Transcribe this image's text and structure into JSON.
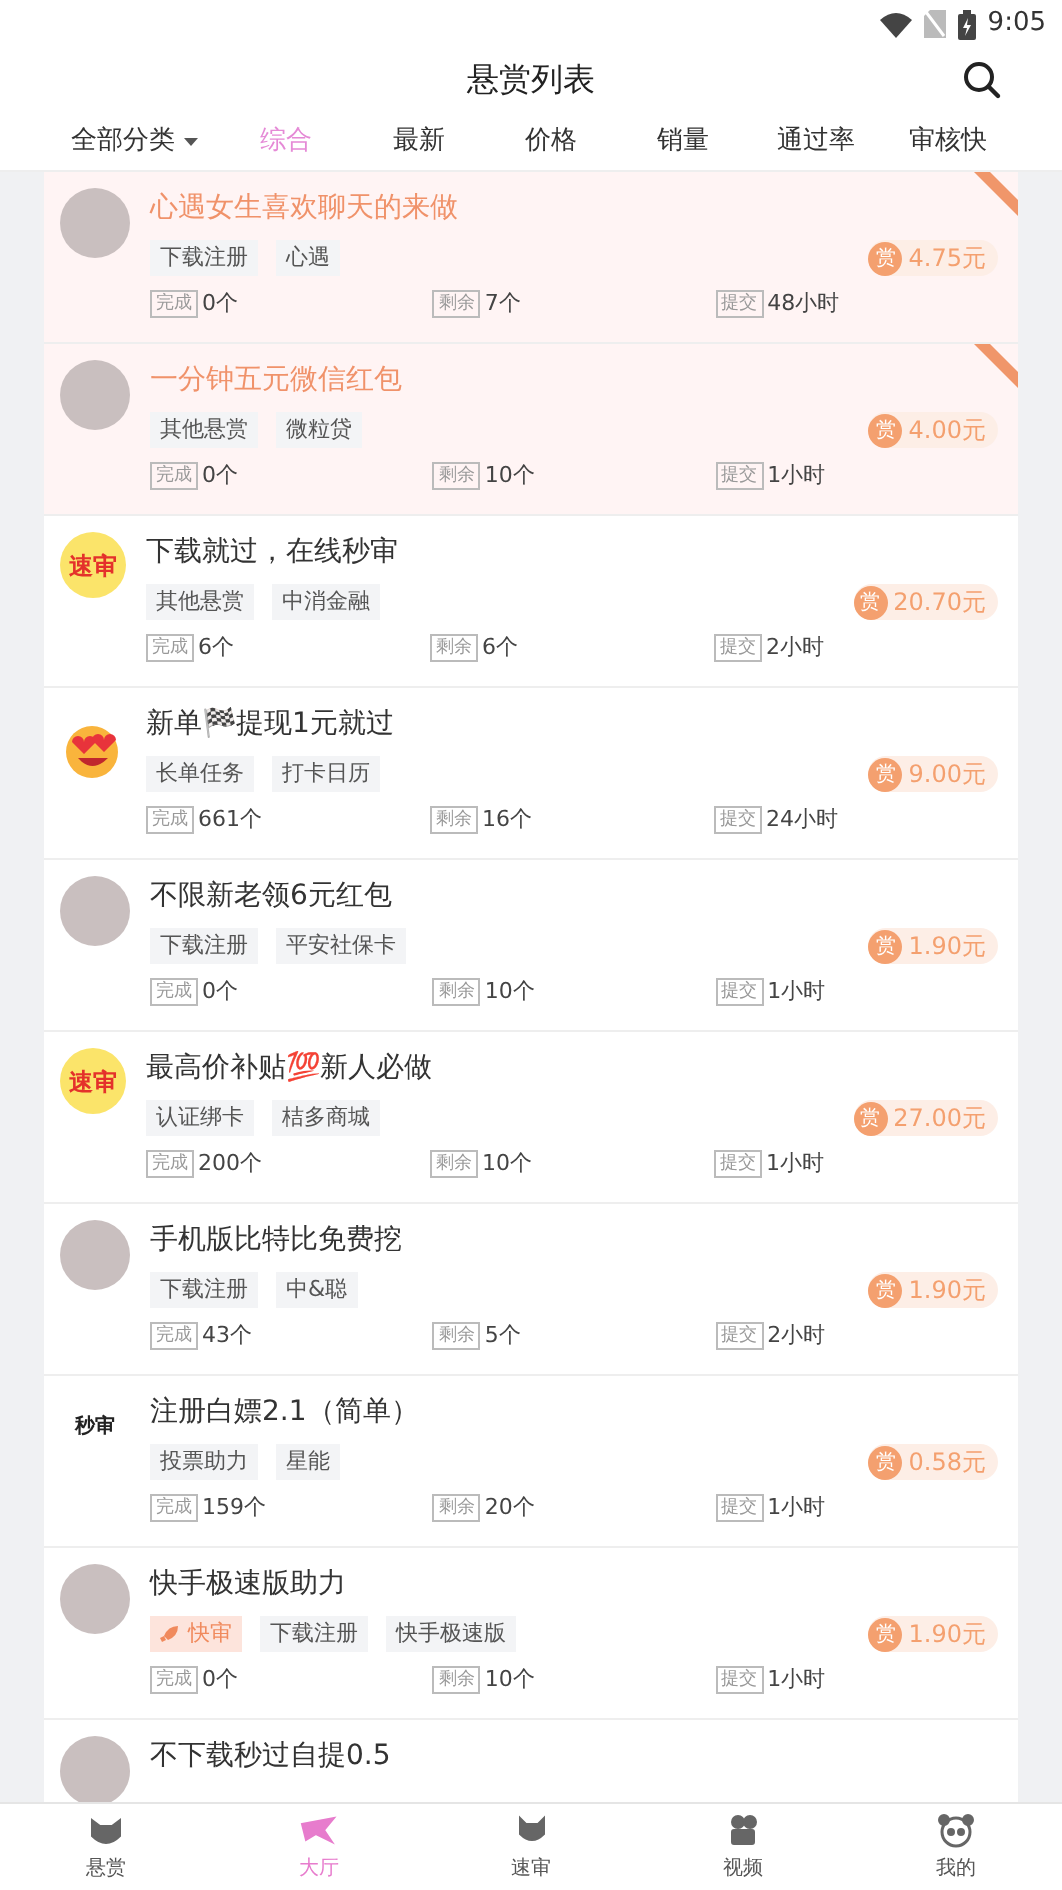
{
  "status_bar": {
    "time": "9:05"
  },
  "header": {
    "title": "悬赏列表"
  },
  "filters": [
    {
      "label": "全部分类",
      "kind": "dropdown",
      "selected": false
    },
    {
      "label": "综合",
      "kind": "sort",
      "selected": true
    },
    {
      "label": "最新",
      "kind": "sort",
      "selected": false
    },
    {
      "label": "价格",
      "kind": "sort",
      "selected": false
    },
    {
      "label": "销量",
      "kind": "sort",
      "selected": false
    },
    {
      "label": "通过率",
      "kind": "sort",
      "selected": false
    },
    {
      "label": "审核快",
      "kind": "sort",
      "selected": false
    }
  ],
  "tasks": [
    {
      "avatar": {
        "kind": "photo"
      },
      "title": "心遇女生喜欢聊天的来做",
      "pinned": true,
      "tags": [
        {
          "label": "下载注册",
          "kind": "plain"
        },
        {
          "label": "心遇",
          "kind": "plain"
        }
      ],
      "reward_mark": "赏",
      "price": "4.75元",
      "stats": [
        {
          "label": "完成",
          "value": "0个"
        },
        {
          "label": "剩余",
          "value": "7个"
        },
        {
          "label": "提交",
          "value": "48小时"
        }
      ]
    },
    {
      "avatar": {
        "kind": "photo"
      },
      "title": "一分钟五元微信红包",
      "pinned": true,
      "tags": [
        {
          "label": "其他悬赏",
          "kind": "plain"
        },
        {
          "label": "微粒贷",
          "kind": "plain"
        }
      ],
      "reward_mark": "赏",
      "price": "4.00元",
      "stats": [
        {
          "label": "完成",
          "value": "0个"
        },
        {
          "label": "剩余",
          "value": "10个"
        },
        {
          "label": "提交",
          "value": "1小时"
        }
      ]
    },
    {
      "avatar": {
        "kind": "badge",
        "text": "速审"
      },
      "title": "下载就过，在线秒审",
      "pinned": false,
      "tags": [
        {
          "label": "其他悬赏",
          "kind": "plain"
        },
        {
          "label": "中消金融",
          "kind": "plain"
        }
      ],
      "reward_mark": "赏",
      "price": "20.70元",
      "stats": [
        {
          "label": "完成",
          "value": "6个"
        },
        {
          "label": "剩余",
          "value": "6个"
        },
        {
          "label": "提交",
          "value": "2小时"
        }
      ]
    },
    {
      "avatar": {
        "kind": "emoji"
      },
      "title": "新单🏁提现1元就过",
      "pinned": false,
      "tags": [
        {
          "label": "长单任务",
          "kind": "plain"
        },
        {
          "label": "打卡日历",
          "kind": "plain"
        }
      ],
      "reward_mark": "赏",
      "price": "9.00元",
      "stats": [
        {
          "label": "完成",
          "value": "661个"
        },
        {
          "label": "剩余",
          "value": "16个"
        },
        {
          "label": "提交",
          "value": "24小时"
        }
      ]
    },
    {
      "avatar": {
        "kind": "photo"
      },
      "title": "不限新老领6元红包",
      "pinned": false,
      "tags": [
        {
          "label": "下载注册",
          "kind": "plain"
        },
        {
          "label": "平安社保卡",
          "kind": "plain"
        }
      ],
      "reward_mark": "赏",
      "price": "1.90元",
      "stats": [
        {
          "label": "完成",
          "value": "0个"
        },
        {
          "label": "剩余",
          "value": "10个"
        },
        {
          "label": "提交",
          "value": "1小时"
        }
      ]
    },
    {
      "avatar": {
        "kind": "badge",
        "text": "速审"
      },
      "title": "最高价补贴💯新人必做",
      "pinned": false,
      "tags": [
        {
          "label": "认证绑卡",
          "kind": "plain"
        },
        {
          "label": "桔多商城",
          "kind": "plain"
        }
      ],
      "reward_mark": "赏",
      "price": "27.00元",
      "stats": [
        {
          "label": "完成",
          "value": "200个"
        },
        {
          "label": "剩余",
          "value": "10个"
        },
        {
          "label": "提交",
          "value": "1小时"
        }
      ]
    },
    {
      "avatar": {
        "kind": "photo"
      },
      "title": "手机版比特比免费挖",
      "pinned": false,
      "tags": [
        {
          "label": "下载注册",
          "kind": "plain"
        },
        {
          "label": "中&聪",
          "kind": "plain"
        }
      ],
      "reward_mark": "赏",
      "price": "1.90元",
      "stats": [
        {
          "label": "完成",
          "value": "43个"
        },
        {
          "label": "剩余",
          "value": "5个"
        },
        {
          "label": "提交",
          "value": "2小时"
        }
      ]
    },
    {
      "avatar": {
        "kind": "text",
        "text": "秒审"
      },
      "title": "注册白嫖2.1（简单）",
      "pinned": false,
      "tags": [
        {
          "label": "投票助力",
          "kind": "plain"
        },
        {
          "label": "星能",
          "kind": "plain"
        }
      ],
      "reward_mark": "赏",
      "price": "0.58元",
      "stats": [
        {
          "label": "完成",
          "value": "159个"
        },
        {
          "label": "剩余",
          "value": "20个"
        },
        {
          "label": "提交",
          "value": "1小时"
        }
      ]
    },
    {
      "avatar": {
        "kind": "photo"
      },
      "title": "快手极速版助力",
      "pinned": false,
      "tags": [
        {
          "label": "快审",
          "kind": "fast"
        },
        {
          "label": "下载注册",
          "kind": "plain"
        },
        {
          "label": "快手极速版",
          "kind": "plain"
        }
      ],
      "reward_mark": "赏",
      "price": "1.90元",
      "stats": [
        {
          "label": "完成",
          "value": "0个"
        },
        {
          "label": "剩余",
          "value": "10个"
        },
        {
          "label": "提交",
          "value": "1小时"
        }
      ]
    },
    {
      "avatar": {
        "kind": "photo"
      },
      "title": "不下载秒过自提0.5",
      "pinned": false
    }
  ],
  "bottom_nav": [
    {
      "label": "悬赏",
      "selected": false
    },
    {
      "label": "大厅",
      "selected": true
    },
    {
      "label": "速审",
      "selected": false
    },
    {
      "label": "视频",
      "selected": false
    },
    {
      "label": "我的",
      "selected": false
    }
  ]
}
